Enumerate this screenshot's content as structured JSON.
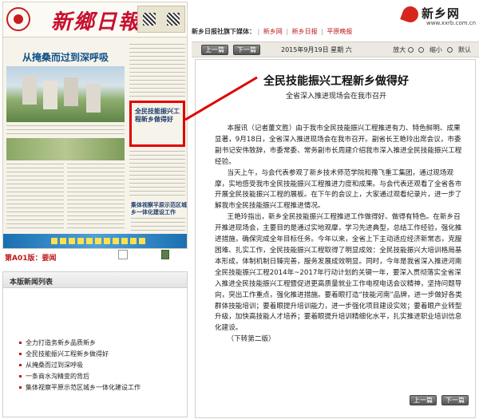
{
  "newspaper": {
    "logo": "新鄉日報",
    "front_headline": "从掩桑而过到深呼吸",
    "highlight_title": "全民技能振兴工程新乡做得好",
    "side_headline": "集体视察平原示范区城乡一体化建设工作",
    "edition_label": "第A01版：",
    "edition_name": "要闻"
  },
  "news_list": {
    "header": "本版新闻列表",
    "items": [
      "全力打造务新乡品质新乡",
      "全民技能振兴工程新乡做得好",
      "从掩桑而过到深呼吸",
      "一条商水沟精变的背后",
      "集体视察平原示范区城乡一体化建设工作"
    ]
  },
  "brand": {
    "name": "新乡网",
    "url": "www.xxrb.com.cn"
  },
  "media_bar": {
    "label": "新乡日报社旗下媒体：",
    "links": [
      "新乡网",
      "新乡日报",
      "平原晚报"
    ]
  },
  "toolbar": {
    "prev": "上一篇",
    "next": "下一篇",
    "date": "2015年9月19日  星期  六",
    "zoom_in": "放大",
    "zoom_out": "缩小",
    "default": "默认"
  },
  "article": {
    "title": "全民技能振兴工程新乡做得好",
    "subtitle": "全省深入推进现场会在我市召开",
    "paragraphs": [
      "本报讯（记者董文胜）由于我市全民技能振兴工程推进有力、特色鲜明、成果显著，9月18日，全省深入推进现场会在我市召开。副省长王艳玲出席会议，市委副书记安伟致辞，市委常委、常务副市长周建介绍我市深入推进全民技能振兴工程经验。",
      "当天上午，与会代表参观了新乡技术师范学院和豫飞重工集团，通过现场观摩，实地感受我市全民技能振兴工程推进力度和成果。与会代表还观看了全省各市开展全民技能振兴工程的展板。在下午的会议上，大家通过观看纪录片，进一步了解我市全民技能振兴工程推进情况。",
      "王艳玲指出，新乡全民技能振兴工程推进工作做得好、做得有特色。在新乡召开推进现场会，主要目的是通过实地观摩，学习先进典型，总结工作经验，强化推进措施，确保完成全年目标任务。今年以来，全省上下主动适应经济新常态，克服困难、扎实工作，全民技能振兴工程取得了明显成效：全民技能振兴大培训格局基本形成，体制机制日臻完善，服务发展成效明显。同时，今年是我省深入推进河南全民技能振兴工程2014年~2017年行动计划的关键一年，要深入贯彻落实全省深入推进全民技能振兴工程暨促进更高质量就业工作电视电话会议精神，坚持问题导向，突出工作重点，强化推进措施。要着眼打造“技能河南”品牌，进一步做好各类群体技能培训；要着眼提升培训能力，进一步强化项目建设实效；要着眼产业转型升级，加快高技能人才培养；要着眼提升培训精细化水平，扎实推进职业培训信息化建设。",
      "（下转第二版）"
    ]
  },
  "colors": {
    "accent_red": "#c0191a",
    "callout_red": "#e10000",
    "masthead_red": "#c8102e"
  }
}
